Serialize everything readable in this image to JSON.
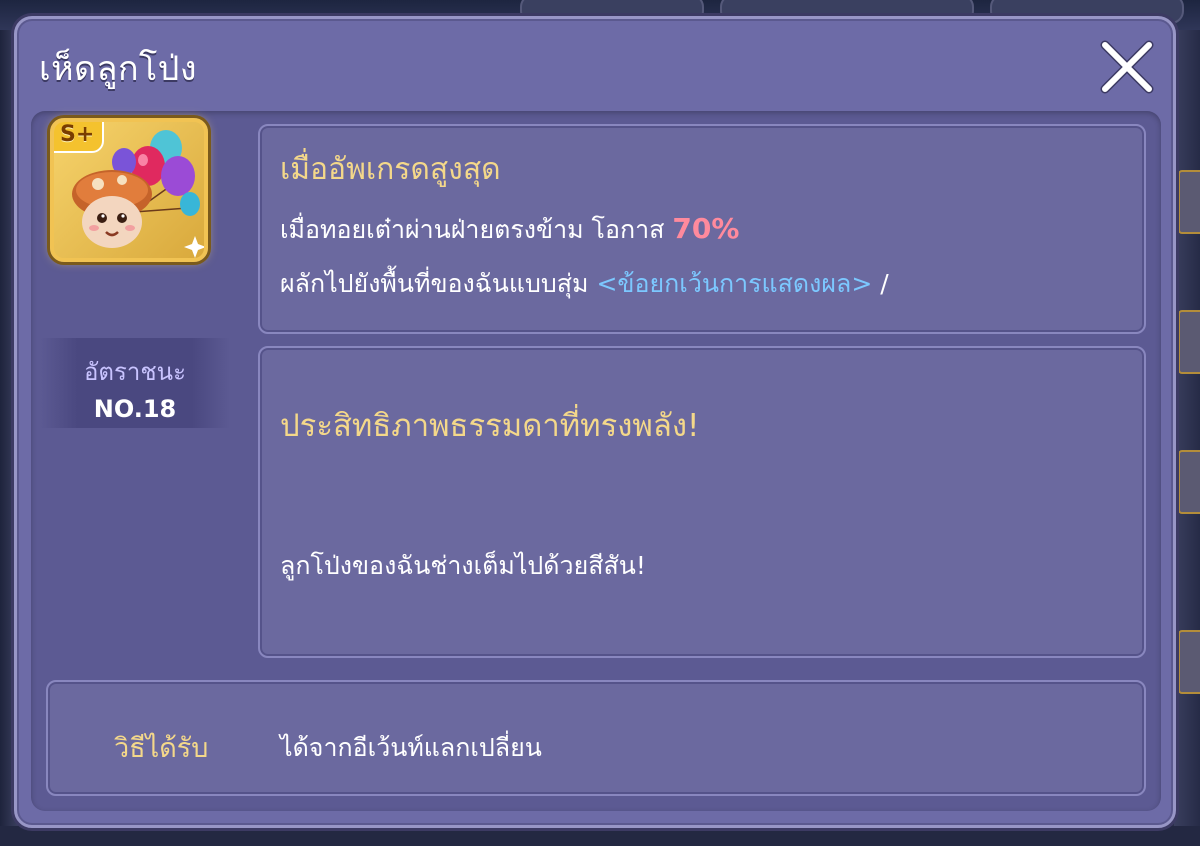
{
  "dialog": {
    "title": "เห็ดลูกโป่ง",
    "close_icon": "close-icon"
  },
  "item": {
    "grade": "S+",
    "icon": "balloon-mushroom-icon",
    "rank_label": "อัตราชนะ",
    "rank_value": "NO.18"
  },
  "skill": {
    "title": "เมื่ออัพเกรดสูงสุด",
    "line1_text": "เมื่อทอยเต๋าผ่านฝ่ายตรงข้าม โอกาส",
    "line1_pct": "70%",
    "line2_text": "ผลักไปยังพื้นที่ของฉันแบบสุ่ม",
    "line2_tag": "<ข้อยกเว้นการแสดงผล>",
    "line2_slash": "/"
  },
  "flavor": {
    "title": "ประสิทธิภาพธรรมดาที่ทรงพลัง!",
    "text": "ลูกโป่งของฉันช่างเต็มไปด้วยสีสัน!"
  },
  "obtain": {
    "label": "วิธีได้รับ",
    "text": "ได้จากอีเว้นท์แลกเปลี่ยน"
  },
  "colors": {
    "dialog_bg": "#6d6ba7",
    "panel_bg": "#6b699f",
    "title_gold": "#f4d88a",
    "percent_pink": "#ff8a9d",
    "tag_blue": "#7cc8ff"
  }
}
